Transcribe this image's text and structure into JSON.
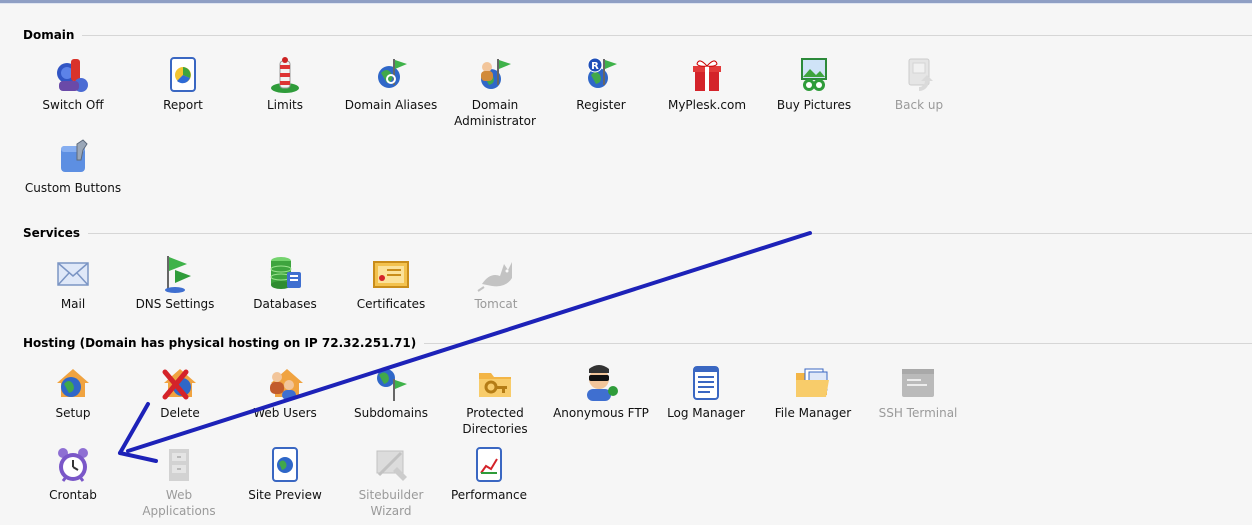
{
  "sections": {
    "domain": {
      "title": "Domain",
      "items": [
        {
          "label": "Switch Off",
          "icon": "switch-off-icon"
        },
        {
          "label": "Report",
          "icon": "report-icon"
        },
        {
          "label": "Limits",
          "icon": "limits-icon"
        },
        {
          "label": "Domain Aliases",
          "icon": "domain-aliases-icon"
        },
        {
          "label": "Domain Administrator",
          "icon": "domain-administrator-icon"
        },
        {
          "label": "Register",
          "icon": "register-icon"
        },
        {
          "label": "MyPlesk.com",
          "icon": "gift-icon"
        },
        {
          "label": "Buy Pictures",
          "icon": "pictures-icon"
        },
        {
          "label": "Back up",
          "icon": "backup-icon"
        },
        {
          "label": "Custom Buttons",
          "icon": "custom-buttons-icon"
        }
      ]
    },
    "services": {
      "title": "Services",
      "items": [
        {
          "label": "Mail",
          "icon": "mail-icon"
        },
        {
          "label": "DNS Settings",
          "icon": "dns-icon"
        },
        {
          "label": "Databases",
          "icon": "database-icon"
        },
        {
          "label": "Certificates",
          "icon": "certificate-icon"
        },
        {
          "label": "Tomcat",
          "icon": "tomcat-icon"
        }
      ]
    },
    "hosting": {
      "title": "Hosting (Domain has physical hosting on IP 72.32.251.71)",
      "items": [
        {
          "label": "Setup",
          "icon": "setup-icon"
        },
        {
          "label": "Delete",
          "icon": "delete-icon"
        },
        {
          "label": "Web Users",
          "icon": "web-users-icon"
        },
        {
          "label": "Subdomains",
          "icon": "subdomains-icon"
        },
        {
          "label": "Protected Directories",
          "icon": "protected-directories-icon"
        },
        {
          "label": "Anonymous FTP",
          "icon": "anonymous-ftp-icon"
        },
        {
          "label": "Log Manager",
          "icon": "log-manager-icon"
        },
        {
          "label": "File Manager",
          "icon": "file-manager-icon"
        },
        {
          "label": "SSH Terminal",
          "icon": "terminal-icon"
        },
        {
          "label": "Crontab",
          "icon": "alarm-clock-icon"
        },
        {
          "label": "Web Applications",
          "icon": "web-applications-icon"
        },
        {
          "label": "Site Preview",
          "icon": "site-preview-icon"
        },
        {
          "label": "Sitebuilder Wizard",
          "icon": "sitebuilder-icon"
        },
        {
          "label": "Performance",
          "icon": "performance-icon"
        }
      ]
    }
  },
  "colors": {
    "annotation_arrow": "#1d22b8",
    "disabled_text": "#9a9a9a"
  }
}
